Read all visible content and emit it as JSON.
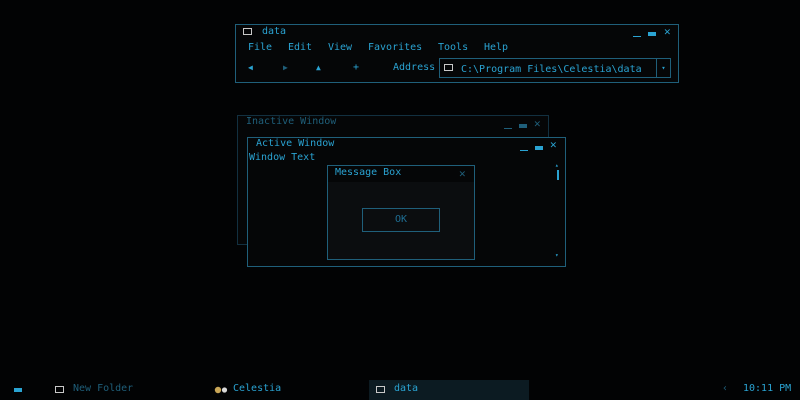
{
  "explorer": {
    "title": "data",
    "menu": [
      "File",
      "Edit",
      "View",
      "Favorites",
      "Tools",
      "Help"
    ],
    "nav": {
      "back": "◀",
      "forward": "▶",
      "up": "▲",
      "new": "+"
    },
    "address_label": "Address",
    "address_value": "C:\\Program Files\\Celestia\\data"
  },
  "inactive_window": {
    "title": "Inactive Window"
  },
  "active_window": {
    "title": "Active Window",
    "text": "Window Text"
  },
  "message_box": {
    "title": "Message Box",
    "ok_label": "OK"
  },
  "taskbar": {
    "items": [
      {
        "label": "New Folder",
        "icon": "folder-icon",
        "active": false
      },
      {
        "label": "Celestia",
        "icon": "celestia-icon",
        "active": false
      },
      {
        "label": "data",
        "icon": "folder-icon",
        "active": true
      }
    ],
    "tray_arrow": "‹",
    "clock": "10:11 PM"
  },
  "colors": {
    "accent": "#2aa3d2",
    "border": "#1f5f7a",
    "background": "#020304"
  }
}
